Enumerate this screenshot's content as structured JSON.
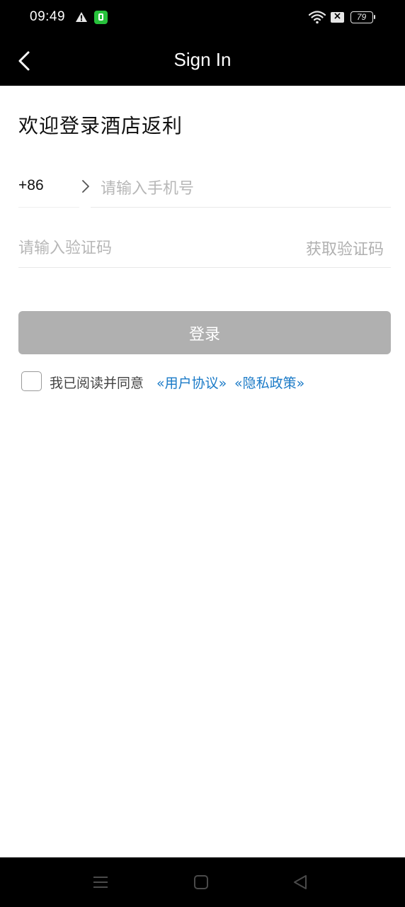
{
  "status_bar": {
    "time": "09:49",
    "battery": "79",
    "icons": [
      "warning-icon",
      "app-icon",
      "wifi-icon",
      "x-box-icon",
      "battery-icon"
    ]
  },
  "nav": {
    "title": "Sign In",
    "back_icon": "chevron-left-icon"
  },
  "form": {
    "welcome": "欢迎登录酒店返利",
    "country_code": "+86",
    "phone_placeholder": "请输入手机号",
    "code_placeholder": "请输入验证码",
    "get_code": "获取验证码",
    "login": "登录",
    "agree_text": "我已阅读并同意",
    "user_agreement": "«用户协议»",
    "privacy_policy": "«隐私政策»"
  },
  "colors": {
    "header_bg": "#000000",
    "button_disabled": "#b0b0b0",
    "link": "#1a7ac7",
    "placeholder": "#b7b7b7"
  },
  "system_nav": {
    "icons": [
      "menu-icon",
      "home-icon",
      "back-triangle-icon"
    ]
  }
}
